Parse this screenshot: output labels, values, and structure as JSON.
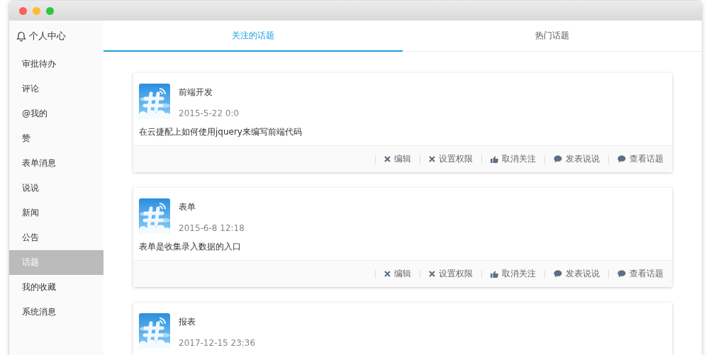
{
  "sidebar": {
    "title": "个人中心",
    "items": [
      {
        "label": "审批待办",
        "selected": false
      },
      {
        "label": "评论",
        "selected": false
      },
      {
        "label": "@我的",
        "selected": false
      },
      {
        "label": "赞",
        "selected": false
      },
      {
        "label": "表单消息",
        "selected": false
      },
      {
        "label": "说说",
        "selected": false
      },
      {
        "label": "新闻",
        "selected": false
      },
      {
        "label": "公告",
        "selected": false
      },
      {
        "label": "话题",
        "selected": true
      },
      {
        "label": "我的收藏",
        "selected": false
      },
      {
        "label": "系统消息",
        "selected": false
      }
    ]
  },
  "tabs": [
    {
      "label": "关注的话题",
      "selected": true
    },
    {
      "label": "热门话题",
      "selected": false
    }
  ],
  "topics": [
    {
      "title": "前端开发",
      "time": "2015-5-22 0:0",
      "description": "在云捷配上如何使用jquery来编写前端代码",
      "actions": [
        {
          "kind": "cross",
          "label": "编辑"
        },
        {
          "kind": "cross",
          "label": "设置权限"
        },
        {
          "kind": "thumb",
          "label": "取消关注"
        },
        {
          "kind": "comment",
          "label": "发表说说"
        },
        {
          "kind": "comment",
          "label": "查看话题"
        }
      ]
    },
    {
      "title": "表单",
      "time": "2015-6-8 12:18",
      "description": "表单是收集录入数据的入口",
      "actions": [
        {
          "kind": "cross",
          "label": "编辑"
        },
        {
          "kind": "cross",
          "label": "设置权限"
        },
        {
          "kind": "thumb",
          "label": "取消关注"
        },
        {
          "kind": "comment",
          "label": "发表说说"
        },
        {
          "kind": "comment",
          "label": "查看话题"
        }
      ]
    },
    {
      "title": "报表",
      "time": "2017-12-15 23:36"
    }
  ]
}
